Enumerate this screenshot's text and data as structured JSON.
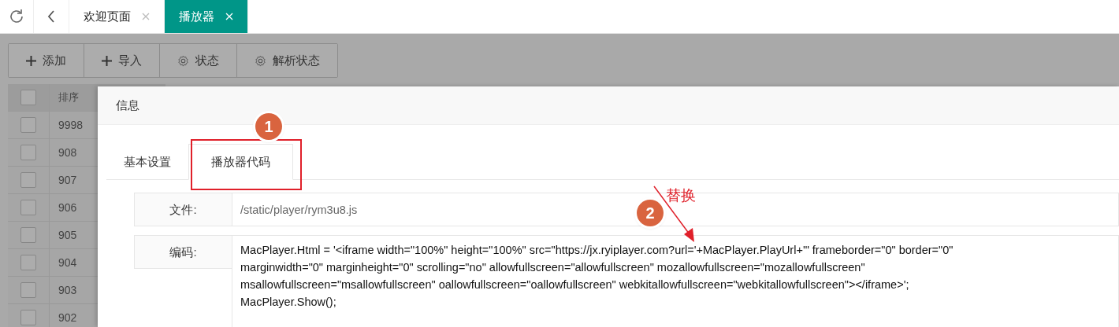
{
  "nav_tabs": [
    {
      "label": "欢迎页面",
      "selected": false
    },
    {
      "label": "播放器",
      "selected": true
    }
  ],
  "toolbar": [
    {
      "kind": "plus",
      "label": "添加"
    },
    {
      "kind": "plus",
      "label": "导入"
    },
    {
      "kind": "gear",
      "label": "状态"
    },
    {
      "kind": "gear",
      "label": "解析状态"
    }
  ],
  "table": {
    "columns": [
      "排序"
    ],
    "all_checked": false,
    "rows": [
      {
        "checked": false,
        "order": "9998"
      },
      {
        "checked": false,
        "order": "908"
      },
      {
        "checked": false,
        "order": "907"
      },
      {
        "checked": false,
        "order": "906"
      },
      {
        "checked": false,
        "order": "905"
      },
      {
        "checked": false,
        "order": "904"
      },
      {
        "checked": false,
        "order": "903"
      },
      {
        "checked": false,
        "order": "902"
      }
    ]
  },
  "dialog": {
    "title": "信息",
    "tabs": [
      {
        "label": "基本设置",
        "selected": false
      },
      {
        "label": "播放器代码",
        "selected": true
      }
    ],
    "fields": [
      {
        "label": "文件:",
        "value": "/static/player/rym3u8.js"
      },
      {
        "label": "编码:",
        "value": "MacPlayer.Html = '<iframe width=\"100%\" height=\"100%\" src=\"https://jx.ryiplayer.com?url='+MacPlayer.PlayUrl+'\" frameborder=\"0\" border=\"0\"\nmarginwidth=\"0\" marginheight=\"0\" scrolling=\"no\" allowfullscreen=\"allowfullscreen\" mozallowfullscreen=\"mozallowfullscreen\"\nmsallowfullscreen=\"msallowfullscreen\" oallowfullscreen=\"oallowfullscreen\" webkitallowfullscreen=\"webkitallowfullscreen\"></iframe>';\nMacPlayer.Show();"
      }
    ]
  },
  "annotations": {
    "markers": [
      "1",
      "2"
    ],
    "note": "替换"
  }
}
